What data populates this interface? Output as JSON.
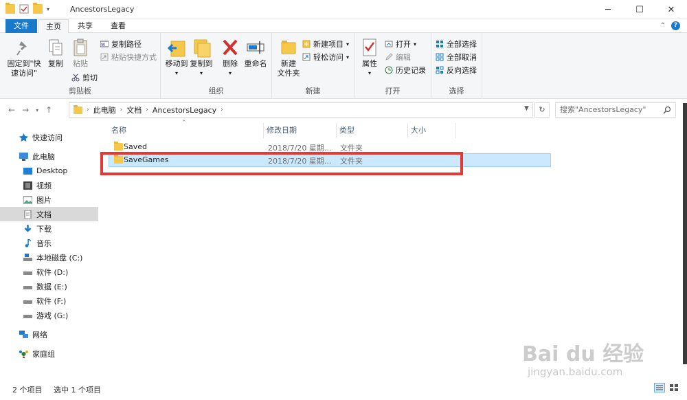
{
  "window": {
    "title": "AncestorsLegacy"
  },
  "tabs": [
    {
      "label": "文件"
    },
    {
      "label": "主页"
    },
    {
      "label": "共享"
    },
    {
      "label": "查看"
    }
  ],
  "ribbon": {
    "clipboard": {
      "pin_label_1": "固定到\"快",
      "pin_label_2": "速访问\"",
      "copy": "复制",
      "paste": "粘贴",
      "copy_path": "复制路径",
      "paste_shortcut": "粘贴快捷方式",
      "cut": "剪切",
      "group": "剪贴板"
    },
    "organize": {
      "move_to": "移动到",
      "copy_to": "复制到",
      "delete": "删除",
      "rename": "重命名",
      "group": "组织"
    },
    "new": {
      "new_folder_1": "新建",
      "new_folder_2": "文件夹",
      "new_item": "新建项目",
      "easy_access": "轻松访问",
      "group": "新建"
    },
    "open": {
      "properties": "属性",
      "open": "打开",
      "edit": "编辑",
      "history": "历史记录",
      "group": "打开"
    },
    "select": {
      "select_all": "全部选择",
      "select_none": "全部取消",
      "invert": "反向选择",
      "group": "选择"
    }
  },
  "address": {
    "crumbs": [
      "此电脑",
      "文档",
      "AncestorsLegacy"
    ],
    "search_placeholder": "搜索\"AncestorsLegacy\""
  },
  "nav": {
    "items": [
      {
        "label": "快速访问"
      },
      {
        "label": "此电脑"
      },
      {
        "label": "Desktop"
      },
      {
        "label": "视频"
      },
      {
        "label": "图片"
      },
      {
        "label": "文档"
      },
      {
        "label": "下载"
      },
      {
        "label": "音乐"
      },
      {
        "label": "本地磁盘 (C:)"
      },
      {
        "label": "软件 (D:)"
      },
      {
        "label": "数据 (E:)"
      },
      {
        "label": "软件 (F:)"
      },
      {
        "label": "游戏 (G:)"
      },
      {
        "label": "网络"
      },
      {
        "label": "家庭组"
      }
    ]
  },
  "columns": [
    "名称",
    "修改日期",
    "类型",
    "大小"
  ],
  "files": [
    {
      "name": "Saved",
      "date": "2018/7/20 星期...",
      "type": "文件夹",
      "size": ""
    },
    {
      "name": "SaveGames",
      "date": "2018/7/20 星期...",
      "type": "文件夹",
      "size": ""
    }
  ],
  "status": {
    "count": "2 个项目",
    "selected": "选中 1 个项目"
  },
  "watermark": {
    "line1": "Bai du 经验",
    "line2": "jingyan.baidu.com"
  },
  "colors": {
    "accent": "#1979ca",
    "selection": "#cce8ff",
    "highlight_box": "#e53935",
    "folder": "#f5c84c"
  }
}
